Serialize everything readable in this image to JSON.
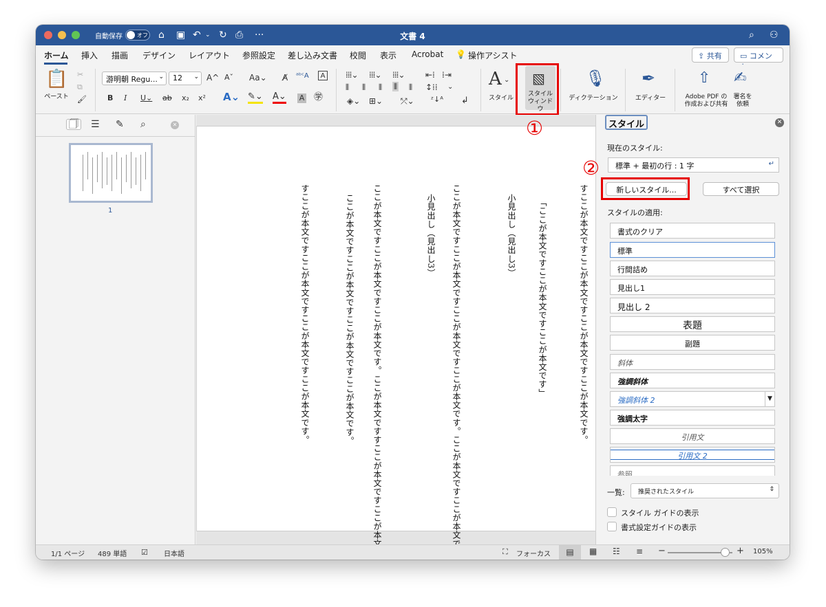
{
  "window": {
    "title": "文書 4",
    "autosave_label": "自動保存",
    "autosave_state": "オフ"
  },
  "colors": {
    "title_bar": "#2b5797",
    "callout": "#e60000",
    "accent": "#2b5797"
  },
  "tabs": [
    "ホーム",
    "挿入",
    "描画",
    "デザイン",
    "レイアウト",
    "参照設定",
    "差し込み文書",
    "校閲",
    "表示",
    "Acrobat",
    "操作アシスト"
  ],
  "header_buttons": {
    "share": "共有",
    "comment": "コメント"
  },
  "ribbon": {
    "paste": "ペースト",
    "font_name": "游明朝 Regu...",
    "font_size": "12",
    "style_gallery": "スタイル",
    "style_window": [
      "スタイル",
      "ウィンドウ"
    ],
    "dictation": "ディクテーション",
    "editor": "エディター",
    "adobe_pdf": [
      "Adobe PDF の",
      "作成および共有"
    ],
    "sign_request": [
      "署名を",
      "依頼"
    ]
  },
  "callouts": {
    "one": "①",
    "two": "②"
  },
  "navigation": {
    "page_number": "1"
  },
  "document": {
    "columns": [
      "すここが本文ですここが本文ですここが本文ですここが本文です。",
      "「ここが本文ですここが本文ですここが本文です」",
      "小見出し（見出し3）",
      "ここが本文ですここが本文ですここが本文ですここが本文です。ここが本文ですここが本文ですここが本文ですここが本文です。",
      "小見出し（見出し3）",
      "ここが本文ですここが本文ですここが本文です。ここが本文ですすここが本文ですここが本文ですここが本文ですここが本文です。",
      "ここが本文ですここが本文ですここが本文ですここが本文です。",
      "すここが本文ですここが本文ですここが本文ですここが本文です。"
    ]
  },
  "styles_pane": {
    "title": "スタイル",
    "current_label": "現在のスタイル:",
    "current_value": "標準 + 最初の行 : 1 字",
    "new_style_button": "新しいスタイル...",
    "select_all_button": "すべて選択",
    "apply_label": "スタイルの適用:",
    "styles": [
      "書式のクリア",
      "標準",
      "行間詰め",
      "見出し1",
      "見出し 2",
      "表題",
      "副題",
      "斜体",
      "強調斜体",
      "強調斜体 2",
      "強調太字",
      "引用文",
      "引用文 2",
      "参照"
    ],
    "list_label": "一覧:",
    "list_value": "推奨されたスタイル",
    "checkboxes": [
      "スタイル ガイドの表示",
      "書式設定ガイドの表示"
    ]
  },
  "status_bar": {
    "page": "1/1 ページ",
    "words": "489 単語",
    "language": "日本語",
    "focus": "フォーカス",
    "zoom": "105%"
  }
}
